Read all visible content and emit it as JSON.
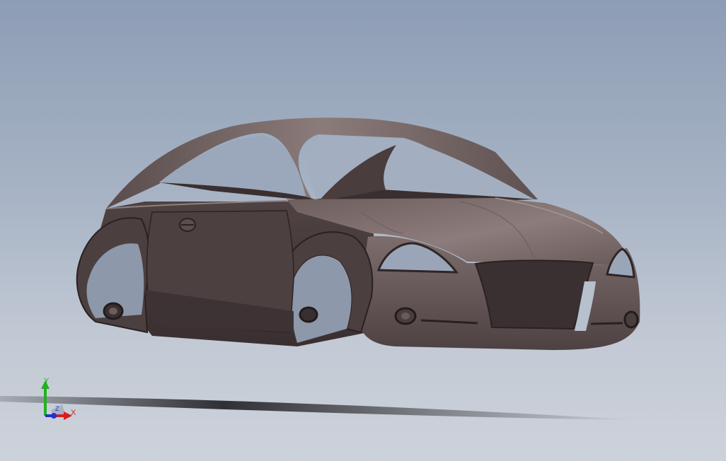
{
  "viewport": {
    "model": "car-body",
    "background_top": "#8d9db5",
    "background_bottom": "#cdd2da",
    "body_color": "#5b4d4e",
    "body_highlight": "#8a7a79",
    "body_shadow": "#2e2526"
  },
  "triad": {
    "x_label": "X",
    "y_label": "Y",
    "z_label": "Z",
    "x_color": "#d81e1e",
    "y_color": "#22b022",
    "z_color": "#2233cc"
  }
}
